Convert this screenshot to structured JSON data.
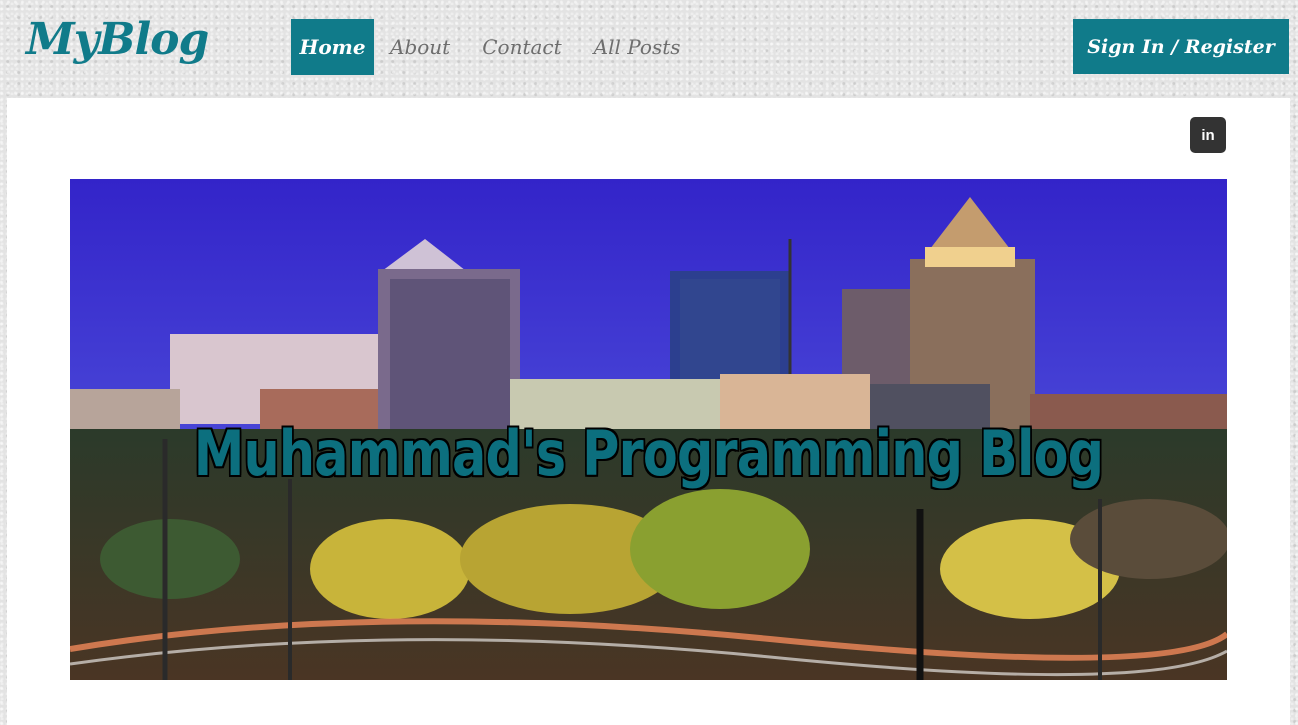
{
  "header": {
    "logo": "MyBlog",
    "nav": [
      {
        "label": "Home",
        "active": true
      },
      {
        "label": "About",
        "active": false
      },
      {
        "label": "Contact",
        "active": false
      },
      {
        "label": "All Posts",
        "active": false
      }
    ],
    "signin_label": "Sign In / Register"
  },
  "social": {
    "linkedin_label": "in",
    "icon": "linkedin-icon"
  },
  "banner": {
    "title": "Muhammad's Programming Blog",
    "image": "city-skyline-night-photo"
  },
  "colors": {
    "accent": "#107b8a",
    "nav_text": "#6e6e6e",
    "panel_bg": "#ffffff",
    "linkedin_bg": "#333333"
  }
}
